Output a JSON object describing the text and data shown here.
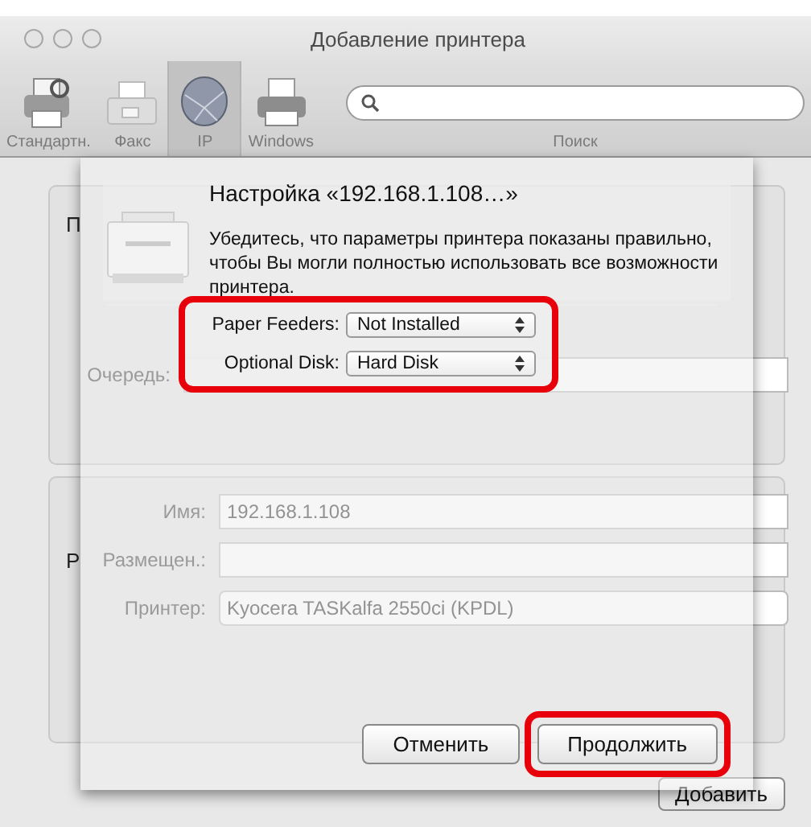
{
  "window": {
    "title": "Добавление принтера"
  },
  "toolbar": {
    "items": [
      {
        "label": "Стандартн.",
        "kind": "default",
        "selected": false
      },
      {
        "label": "Факс",
        "kind": "fax",
        "selected": false
      },
      {
        "label": "IP",
        "kind": "ip",
        "selected": true
      },
      {
        "label": "Windows",
        "kind": "windows",
        "selected": false
      }
    ],
    "search_label": "Поиск"
  },
  "back_form": {
    "group1_label": "П",
    "queue_label": "Очередь:",
    "group2_label": "Р",
    "fields": [
      {
        "label": "Имя:",
        "value": "192.168.1.108",
        "kind": "text"
      },
      {
        "label": "Размещен.:",
        "kind": "text"
      },
      {
        "label": "Принтер:",
        "value": "Kyocera TASKalfa 2550ci (KPDL)",
        "kind": "popup"
      }
    ]
  },
  "sheet": {
    "title": "Настройка «192.168.1.108…»",
    "message": "Убедитесь, что параметры принтера показаны правильно, чтобы Вы могли полностью использовать все возможности принтера.",
    "options": [
      {
        "label": "Paper Feeders:",
        "value": "Not Installed"
      },
      {
        "label": "Optional Disk:",
        "value": "Hard Disk"
      }
    ],
    "buttons": [
      {
        "label": "Отменить",
        "highlighted": false
      },
      {
        "label": "Продолжить",
        "highlighted": true
      }
    ]
  },
  "add_button": "Добавить"
}
